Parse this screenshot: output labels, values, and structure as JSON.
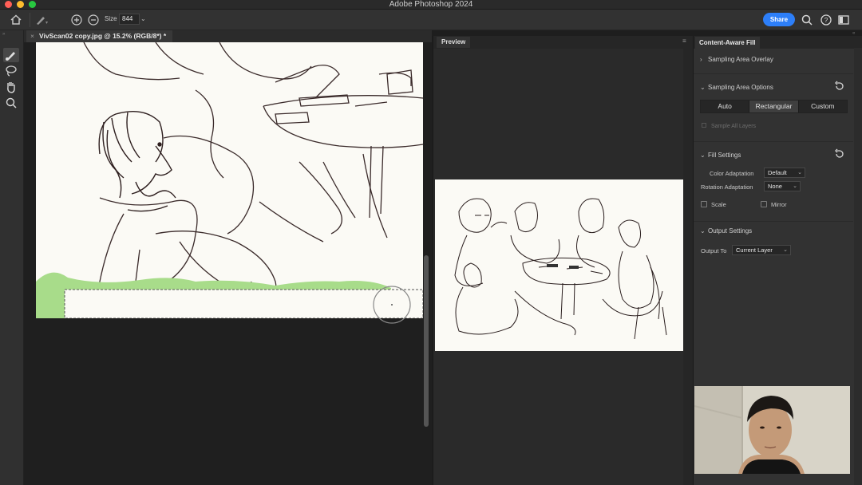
{
  "window": {
    "title": "Adobe Photoshop 2024"
  },
  "options_bar": {
    "size_label": "Size",
    "size_value": "844",
    "share_label": "Share",
    "icons": [
      "home-icon",
      "brush-preset-icon",
      "add-mode-icon",
      "subtract-mode-icon",
      "search-icon",
      "help-icon",
      "workspace-icon"
    ]
  },
  "tools": [
    "sampling-brush-icon",
    "lasso-icon",
    "hand-icon",
    "zoom-icon"
  ],
  "document": {
    "tab_label": "VivScan02 copy.jpg @ 15.2% (RGB/8*) *",
    "close_glyph": "×"
  },
  "preview": {
    "tab_label": "Preview"
  },
  "content_aware_fill": {
    "tab_label": "Content-Aware Fill",
    "sampling_area_overlay": {
      "heading": "Sampling Area Overlay"
    },
    "sampling_area_options": {
      "heading": "Sampling Area Options",
      "modes": [
        "Auto",
        "Rectangular",
        "Custom"
      ],
      "selected_mode": "Custom",
      "sample_all_layers": "Sample All Layers"
    },
    "fill_settings": {
      "heading": "Fill Settings",
      "color_adaptation_label": "Color Adaptation",
      "color_adaptation_value": "Default",
      "rotation_adaptation_label": "Rotation Adaptation",
      "rotation_adaptation_value": "None",
      "scale_label": "Scale",
      "mirror_label": "Mirror"
    },
    "output_settings": {
      "heading": "Output Settings",
      "output_to_label": "Output To",
      "output_to_value": "Current Layer"
    }
  },
  "colors": {
    "accent": "#2d7ff9",
    "overlay_green": "#a8dc8a",
    "panel": "#323232",
    "canvas_paper": "#fbfaf5"
  }
}
